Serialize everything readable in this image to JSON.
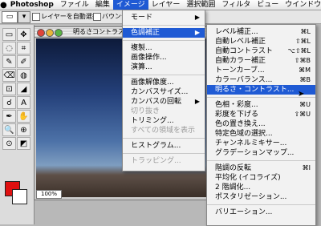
{
  "menubar": {
    "apple": "",
    "app_name": "Photoshop",
    "items": [
      "ファイル",
      "編集",
      "イメージ",
      "レイヤー",
      "選択範囲",
      "フィルタ",
      "ビュー",
      "ウインドウ"
    ]
  },
  "options": {
    "tool_glyph": "▭",
    "option1": "レイヤーを自動選択",
    "option2": "バウンディング"
  },
  "document": {
    "title": "明るさコントラスト",
    "zoom": "100%"
  },
  "image_menu": {
    "items": [
      {
        "label": "モード",
        "arrow": "▶"
      },
      {
        "sep": true
      },
      {
        "label": "色調補正",
        "arrow": "▶",
        "highlight": true
      },
      {
        "sep": true
      },
      {
        "label": "複製..."
      },
      {
        "label": "画像操作..."
      },
      {
        "label": "演算..."
      },
      {
        "sep": true
      },
      {
        "label": "画像解像度..."
      },
      {
        "label": "カンバスサイズ..."
      },
      {
        "label": "カンバスの回転",
        "arrow": "▶"
      },
      {
        "label": "切り抜き",
        "disabled": true
      },
      {
        "label": "トリミング..."
      },
      {
        "label": "すべての領域を表示",
        "disabled": true
      },
      {
        "sep": true
      },
      {
        "label": "ヒストグラム..."
      },
      {
        "sep": true
      },
      {
        "label": "トラッピング...",
        "disabled": true
      }
    ]
  },
  "adjust_menu": {
    "items": [
      {
        "label": "レベル補正...",
        "shortcut": "⌘L"
      },
      {
        "label": "自動レベル補正",
        "shortcut": "⇧⌘L"
      },
      {
        "label": "自動コントラスト",
        "shortcut": "⌥⇧⌘L"
      },
      {
        "label": "自動カラー補正",
        "shortcut": "⇧⌘B"
      },
      {
        "label": "トーンカーブ...",
        "shortcut": "⌘M"
      },
      {
        "label": "カラーバランス...",
        "shortcut": "⌘B"
      },
      {
        "label": "明るさ・コントラスト...",
        "highlight": true
      },
      {
        "sep": true
      },
      {
        "label": "色相・彩度...",
        "shortcut": "⌘U"
      },
      {
        "label": "彩度を下げる",
        "shortcut": "⇧⌘U"
      },
      {
        "label": "色の置き換え..."
      },
      {
        "label": "特定色域の選択..."
      },
      {
        "label": "チャンネルミキサー..."
      },
      {
        "label": "グラデーションマップ..."
      },
      {
        "sep": true
      },
      {
        "label": "階調の反転",
        "shortcut": "⌘I"
      },
      {
        "label": "平均化 (イコライズ)"
      },
      {
        "label": "2 階調化..."
      },
      {
        "label": "ポスタリゼーション..."
      },
      {
        "sep": true
      },
      {
        "label": "バリエーション..."
      }
    ]
  },
  "colors": {
    "foreground": "#e01010",
    "background": "#ffffff",
    "highlight": "#1f5ad4"
  },
  "tools": [
    "▭",
    "✥",
    "◌",
    "⌗",
    "✎",
    "✐",
    "⌫",
    "◍",
    "⊡",
    "◢",
    "☌",
    "A",
    "✒",
    "✋",
    "🔍",
    "⊕",
    "⊙",
    "◩"
  ]
}
